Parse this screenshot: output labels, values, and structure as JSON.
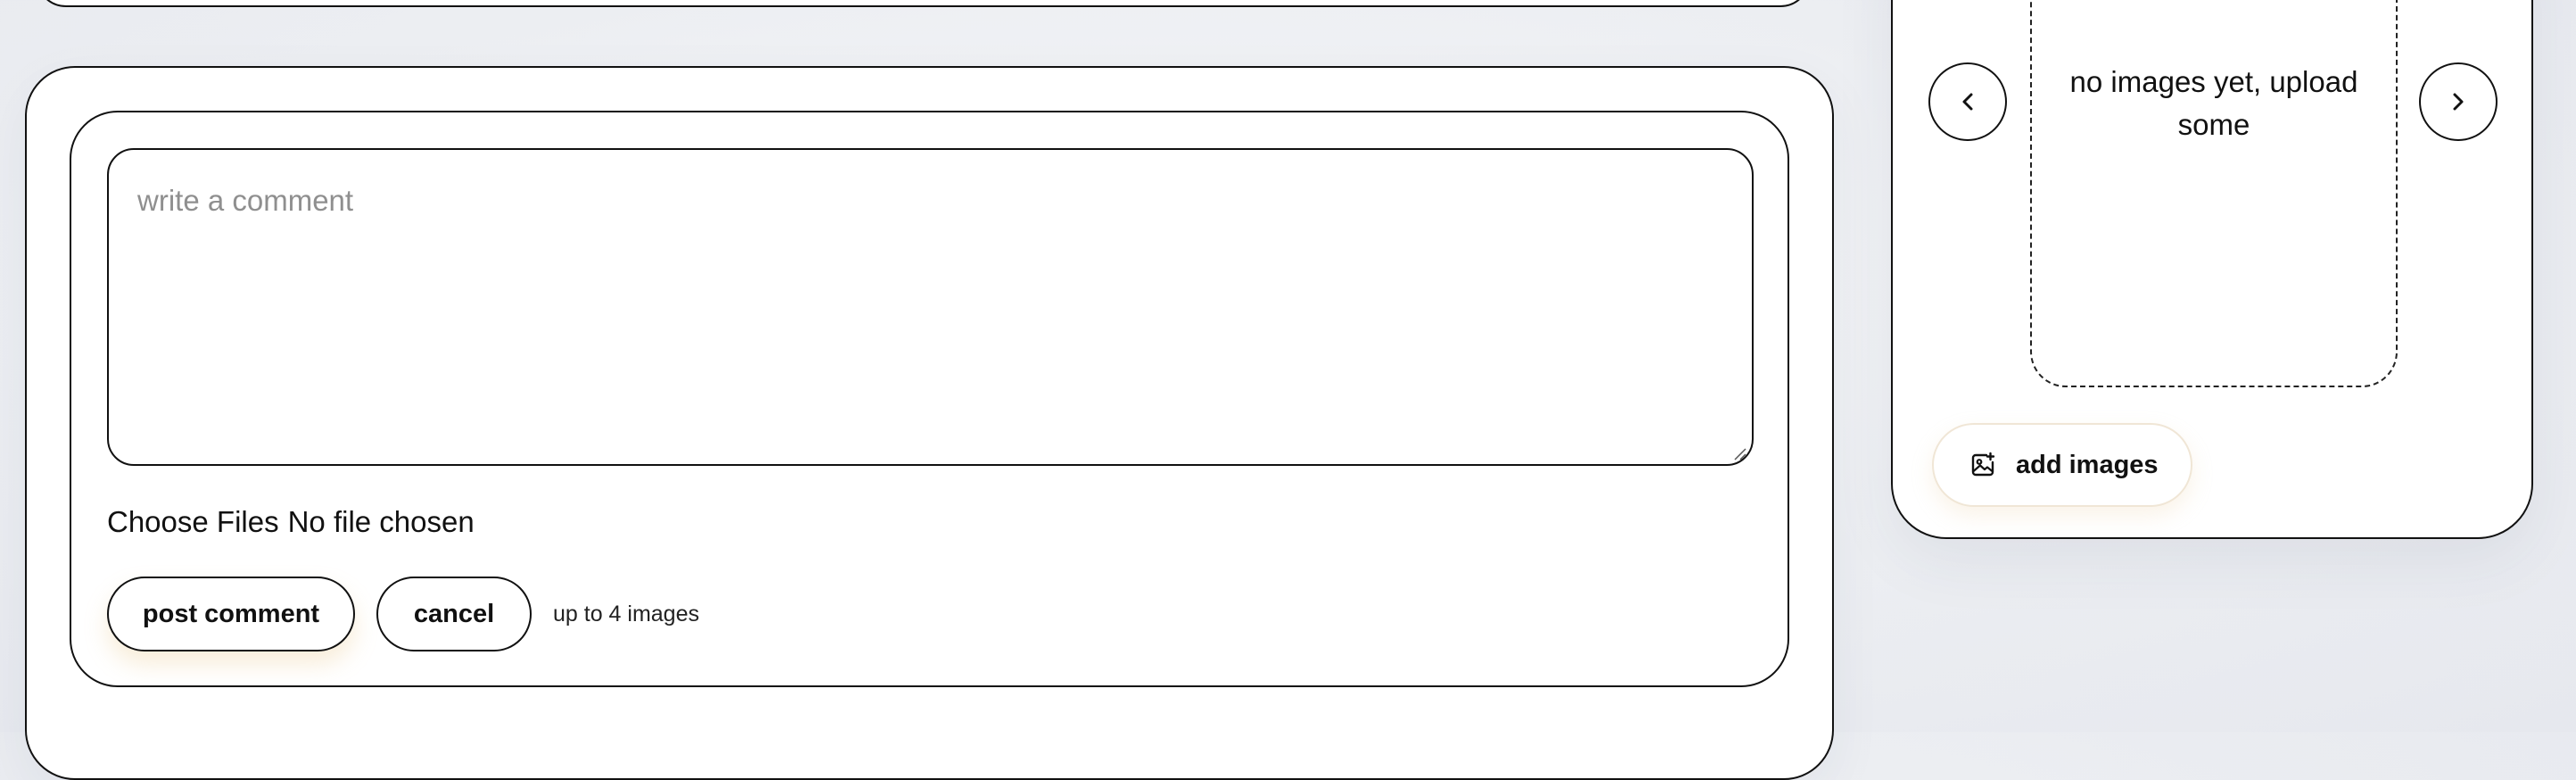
{
  "comment_form": {
    "placeholder": "write a comment",
    "file_input": {
      "button_label": "Choose Files",
      "status": "No file chosen"
    },
    "post_label": "post comment",
    "cancel_label": "cancel",
    "limit_note": "up to 4 images"
  },
  "gallery": {
    "empty_text": "no images yet, upload some",
    "prev_icon": "chevron-left-icon",
    "next_icon": "chevron-right-icon",
    "add_images_label": "add images",
    "add_images_icon": "image-add-icon"
  },
  "colors": {
    "border": "#111111",
    "background": "#eceef2",
    "card": "#ffffff",
    "placeholder": "#8f8f8f",
    "glow": "#f0e6d6"
  }
}
